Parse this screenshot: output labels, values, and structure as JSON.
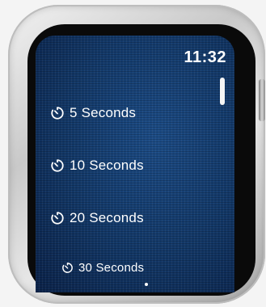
{
  "status": {
    "time": "11:32"
  },
  "timer_options": [
    {
      "label": "5 Seconds",
      "icon": "timer-icon"
    },
    {
      "label": "10 Seconds",
      "icon": "timer-icon"
    },
    {
      "label": "20 Seconds",
      "icon": "timer-icon"
    },
    {
      "label": "30 Seconds",
      "icon": "timer-icon"
    }
  ],
  "colors": {
    "screen_background": "#0d2a56",
    "text": "#ffffff",
    "bezel": "#0a0a0a"
  }
}
